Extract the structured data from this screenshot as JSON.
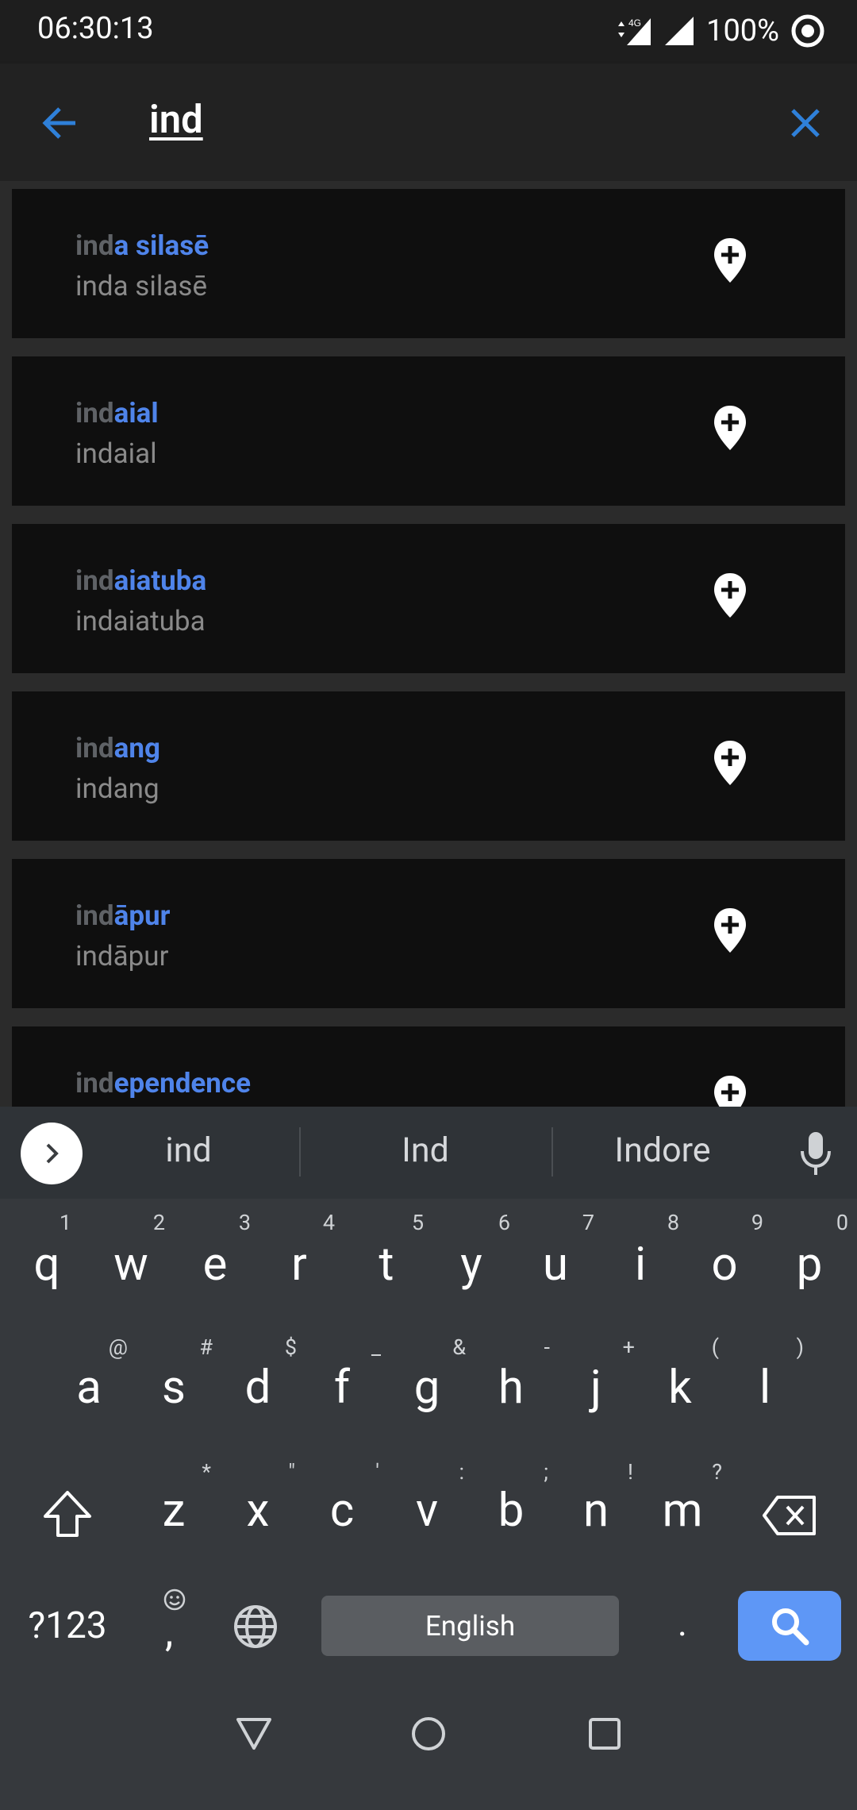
{
  "status_bar": {
    "time": "06:30:13",
    "network": "4G",
    "battery": "100%"
  },
  "search": {
    "query": "ind"
  },
  "results": [
    {
      "title_match": "ind",
      "title_rest": "a silasē",
      "subtitle": "inda silasē"
    },
    {
      "title_match": "ind",
      "title_rest": "aial",
      "subtitle": "indaial"
    },
    {
      "title_match": "ind",
      "title_rest": "aiatuba",
      "subtitle": "indaiatuba"
    },
    {
      "title_match": "ind",
      "title_rest": "ang",
      "subtitle": "indang"
    },
    {
      "title_match": "ind",
      "title_rest": "āpur",
      "subtitle": "indāpur"
    },
    {
      "title_match": "ind",
      "title_rest": "ependence",
      "subtitle": ""
    }
  ],
  "keyboard": {
    "suggestions": [
      "ind",
      "Ind",
      "Indore"
    ],
    "row1": [
      {
        "key": "q",
        "hint": "1"
      },
      {
        "key": "w",
        "hint": "2"
      },
      {
        "key": "e",
        "hint": "3"
      },
      {
        "key": "r",
        "hint": "4"
      },
      {
        "key": "t",
        "hint": "5"
      },
      {
        "key": "y",
        "hint": "6"
      },
      {
        "key": "u",
        "hint": "7"
      },
      {
        "key": "i",
        "hint": "8"
      },
      {
        "key": "o",
        "hint": "9"
      },
      {
        "key": "p",
        "hint": "0"
      }
    ],
    "row2": [
      {
        "key": "a",
        "hint": "@"
      },
      {
        "key": "s",
        "hint": "#"
      },
      {
        "key": "d",
        "hint": "$"
      },
      {
        "key": "f",
        "hint": "_"
      },
      {
        "key": "g",
        "hint": "&"
      },
      {
        "key": "h",
        "hint": "-"
      },
      {
        "key": "j",
        "hint": "+"
      },
      {
        "key": "k",
        "hint": "("
      },
      {
        "key": "l",
        "hint": ")"
      }
    ],
    "row3": [
      {
        "key": "z",
        "hint": "*"
      },
      {
        "key": "x",
        "hint": "\""
      },
      {
        "key": "c",
        "hint": "'"
      },
      {
        "key": "v",
        "hint": ":"
      },
      {
        "key": "b",
        "hint": ";"
      },
      {
        "key": "n",
        "hint": "!"
      },
      {
        "key": "m",
        "hint": "?"
      }
    ],
    "symbols_label": "?123",
    "comma": ",",
    "space_label": "English",
    "period": ".",
    "accent_color": "#5e97f6"
  },
  "icons": {
    "back": "arrow-left-icon",
    "clear": "close-icon",
    "pin": "add-location-icon",
    "mic": "microphone-icon",
    "globe": "globe-icon",
    "shift": "shift-icon",
    "backspace": "backspace-icon",
    "search": "search-icon"
  },
  "colors": {
    "accent_blue": "#2f80d9",
    "match_gray": "#5f6266",
    "rest_blue": "#4f84ea"
  }
}
